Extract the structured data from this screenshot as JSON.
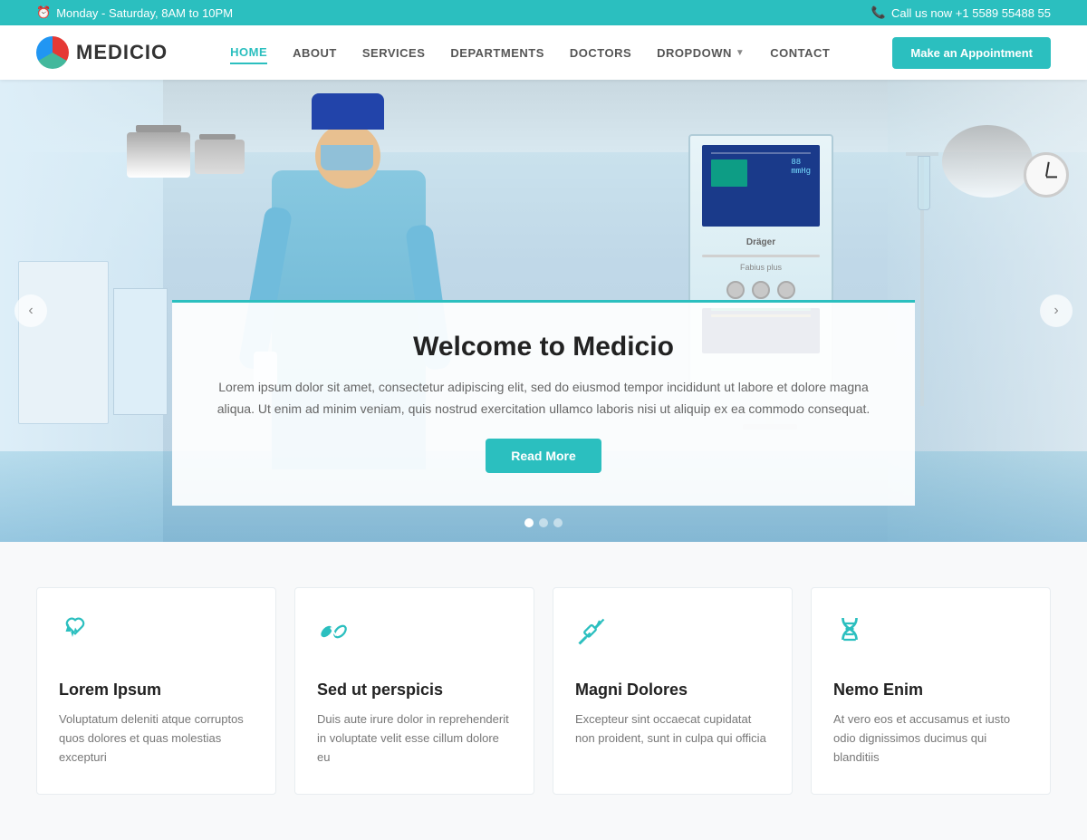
{
  "topbar": {
    "hours": "Monday - Saturday, 8AM to 10PM",
    "phone_label": "Call us now +1 5589 55488 55"
  },
  "header": {
    "logo_text": "MEDICIO",
    "nav": {
      "home": "HOME",
      "about": "ABOUT",
      "services": "SERVICES",
      "departments": "DEPARTMENTS",
      "doctors": "DOCTORS",
      "dropdown": "DROPDOWN",
      "contact": "CONTACT"
    },
    "appointment_btn": "Make an Appointment"
  },
  "hero": {
    "title": "Welcome to Medicio",
    "description": "Lorem ipsum dolor sit amet, consectetur adipiscing elit, sed do eiusmod tempor incididunt ut labore et dolore magna aliqua. Ut enim ad minim veniam, quis nostrud exercitation ullamco laboris nisi ut aliquip ex ea commodo consequat.",
    "btn_label": "Read More",
    "dots": [
      {
        "active": true
      },
      {
        "active": false
      },
      {
        "active": false
      }
    ]
  },
  "services": [
    {
      "icon": "heartbeat",
      "title": "Lorem Ipsum",
      "description": "Voluptatum deleniti atque corruptos quos dolores et quas molestias excepturi"
    },
    {
      "icon": "pills",
      "title": "Sed ut perspicis",
      "description": "Duis aute irure dolor in reprehenderit in voluptate velit esse cillum dolore eu"
    },
    {
      "icon": "syringe",
      "title": "Magni Dolores",
      "description": "Excepteur sint occaecat cupidatat non proident, sunt in culpa qui officia"
    },
    {
      "icon": "dna",
      "title": "Nemo Enim",
      "description": "At vero eos et accusamus et iusto odio dignissimos ducimus qui blanditiis"
    }
  ]
}
